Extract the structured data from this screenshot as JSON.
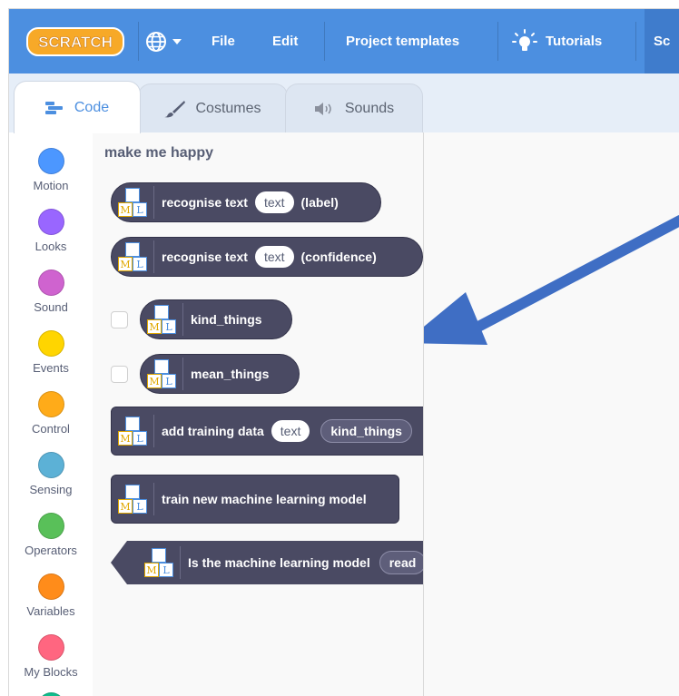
{
  "menu": {
    "logo_text": "SCRATCH",
    "file": "File",
    "edit": "Edit",
    "templates": "Project templates",
    "tutorials": "Tutorials",
    "sc": "Sc"
  },
  "tabs": [
    {
      "label": "Code",
      "icon": "code-icon"
    },
    {
      "label": "Costumes",
      "icon": "brush-icon"
    },
    {
      "label": "Sounds",
      "icon": "speaker-icon"
    }
  ],
  "categories": [
    {
      "label": "Motion",
      "color": "#4c97ff"
    },
    {
      "label": "Looks",
      "color": "#9966ff"
    },
    {
      "label": "Sound",
      "color": "#cf63cf"
    },
    {
      "label": "Events",
      "color": "#ffd500"
    },
    {
      "label": "Control",
      "color": "#ffab19"
    },
    {
      "label": "Sensing",
      "color": "#5cb1d6"
    },
    {
      "label": "Operators",
      "color": "#59c059"
    },
    {
      "label": "Variables",
      "color": "#ff8c1a"
    },
    {
      "label": "My Blocks",
      "color": "#ff6680"
    }
  ],
  "palette": {
    "title": "make me happy",
    "ml_top": "⚛",
    "ml_m": "M",
    "ml_l": "L",
    "blocks": {
      "recognise_label": {
        "text1": "recognise text",
        "input": "text",
        "text2": "(label)"
      },
      "recognise_conf": {
        "text1": "recognise text",
        "input": "text",
        "text2": "(confidence)"
      },
      "kind_things": "kind_things",
      "mean_things": "mean_things",
      "add_training": {
        "text1": "add training data",
        "input": "text",
        "dropdown": "kind_things"
      },
      "train_model": "train new machine learning model",
      "is_ready": {
        "text1": "Is the machine learning model",
        "dropdown": "read"
      }
    }
  },
  "colors": {
    "menubar": "#4c8fe0",
    "block": "#4a4a63",
    "arrow": "#3f6ec4"
  }
}
